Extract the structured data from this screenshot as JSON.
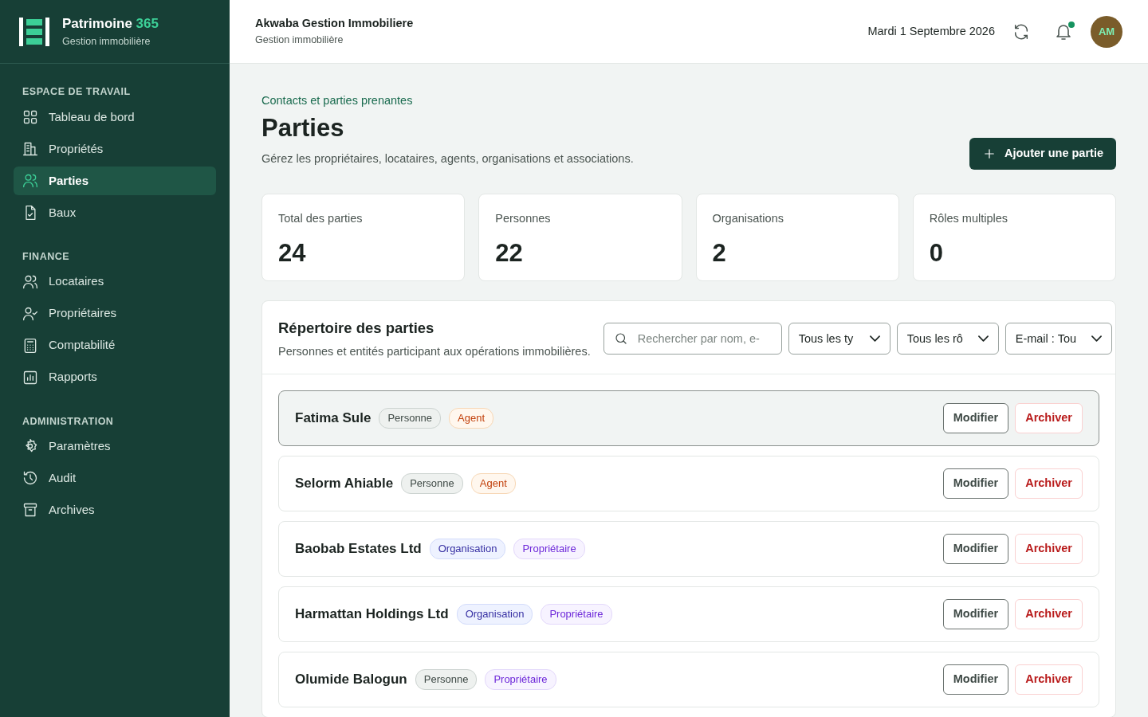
{
  "brand": {
    "name": "Patrimoine",
    "accent": "365",
    "subtitle": "Gestion immobilière"
  },
  "sidebar": {
    "sections": [
      {
        "title": "ESPACE DE TRAVAIL",
        "items": [
          {
            "label": "Tableau de bord",
            "selected": false
          },
          {
            "label": "Propriétés",
            "selected": false
          },
          {
            "label": "Parties",
            "selected": true
          },
          {
            "label": "Baux",
            "selected": false
          }
        ]
      },
      {
        "title": "FINANCE",
        "items": [
          {
            "label": "Locataires",
            "selected": false
          },
          {
            "label": "Propriétaires",
            "selected": false
          },
          {
            "label": "Comptabilité",
            "selected": false
          },
          {
            "label": "Rapports",
            "selected": false
          }
        ]
      },
      {
        "title": "ADMINISTRATION",
        "items": [
          {
            "label": "Paramètres",
            "selected": false
          },
          {
            "label": "Audit",
            "selected": false
          },
          {
            "label": "Archives",
            "selected": false
          }
        ]
      }
    ]
  },
  "header": {
    "company": "Akwaba Gestion Immobiliere",
    "subtitle": "Gestion immobilière",
    "date": "Mardi 1 Septembre 2026",
    "notification": true,
    "avatar": "AM"
  },
  "page": {
    "breadcrumb": "Contacts et parties prenantes",
    "title": "Parties",
    "description": "Gérez les propriétaires, locataires, agents, organisations et associations.",
    "action": "Ajouter une partie"
  },
  "stats": [
    {
      "label": "Total des parties",
      "value": "24"
    },
    {
      "label": "Personnes",
      "value": "22"
    },
    {
      "label": "Organisations",
      "value": "2"
    },
    {
      "label": "Rôles multiples",
      "value": "0"
    }
  ],
  "directory": {
    "title": "Répertoire des parties",
    "subtitle": "Personnes et entités participant aux opérations immobilières.",
    "search": {
      "placeholder": "Rechercher par nom, e-"
    },
    "filters": [
      "Tous les ty",
      "Tous les rô",
      "E-mail : Tou"
    ],
    "rows": [
      {
        "name": "Fatima Sule",
        "selected": true,
        "tags": [
          {
            "label": "Personne",
            "kind": "person"
          },
          {
            "label": "Agent",
            "kind": "agent"
          }
        ],
        "edit": "Modifier",
        "archive": "Archiver"
      },
      {
        "name": "Selorm Ahiable",
        "selected": false,
        "tags": [
          {
            "label": "Personne",
            "kind": "person"
          },
          {
            "label": "Agent",
            "kind": "agent"
          }
        ],
        "edit": "Modifier",
        "archive": "Archiver"
      },
      {
        "name": "Baobab Estates Ltd",
        "selected": false,
        "tags": [
          {
            "label": "Organisation",
            "kind": "organisation"
          },
          {
            "label": "Propriétaire",
            "kind": "owner"
          }
        ],
        "edit": "Modifier",
        "archive": "Archiver"
      },
      {
        "name": "Harmattan Holdings Ltd",
        "selected": false,
        "tags": [
          {
            "label": "Organisation",
            "kind": "organisation"
          },
          {
            "label": "Propriétaire",
            "kind": "owner"
          }
        ],
        "edit": "Modifier",
        "archive": "Archiver"
      },
      {
        "name": "Olumide Balogun",
        "selected": false,
        "tags": [
          {
            "label": "Personne",
            "kind": "person"
          },
          {
            "label": "Propriétaire",
            "kind": "owner"
          }
        ],
        "edit": "Modifier",
        "archive": "Archiver"
      }
    ]
  }
}
